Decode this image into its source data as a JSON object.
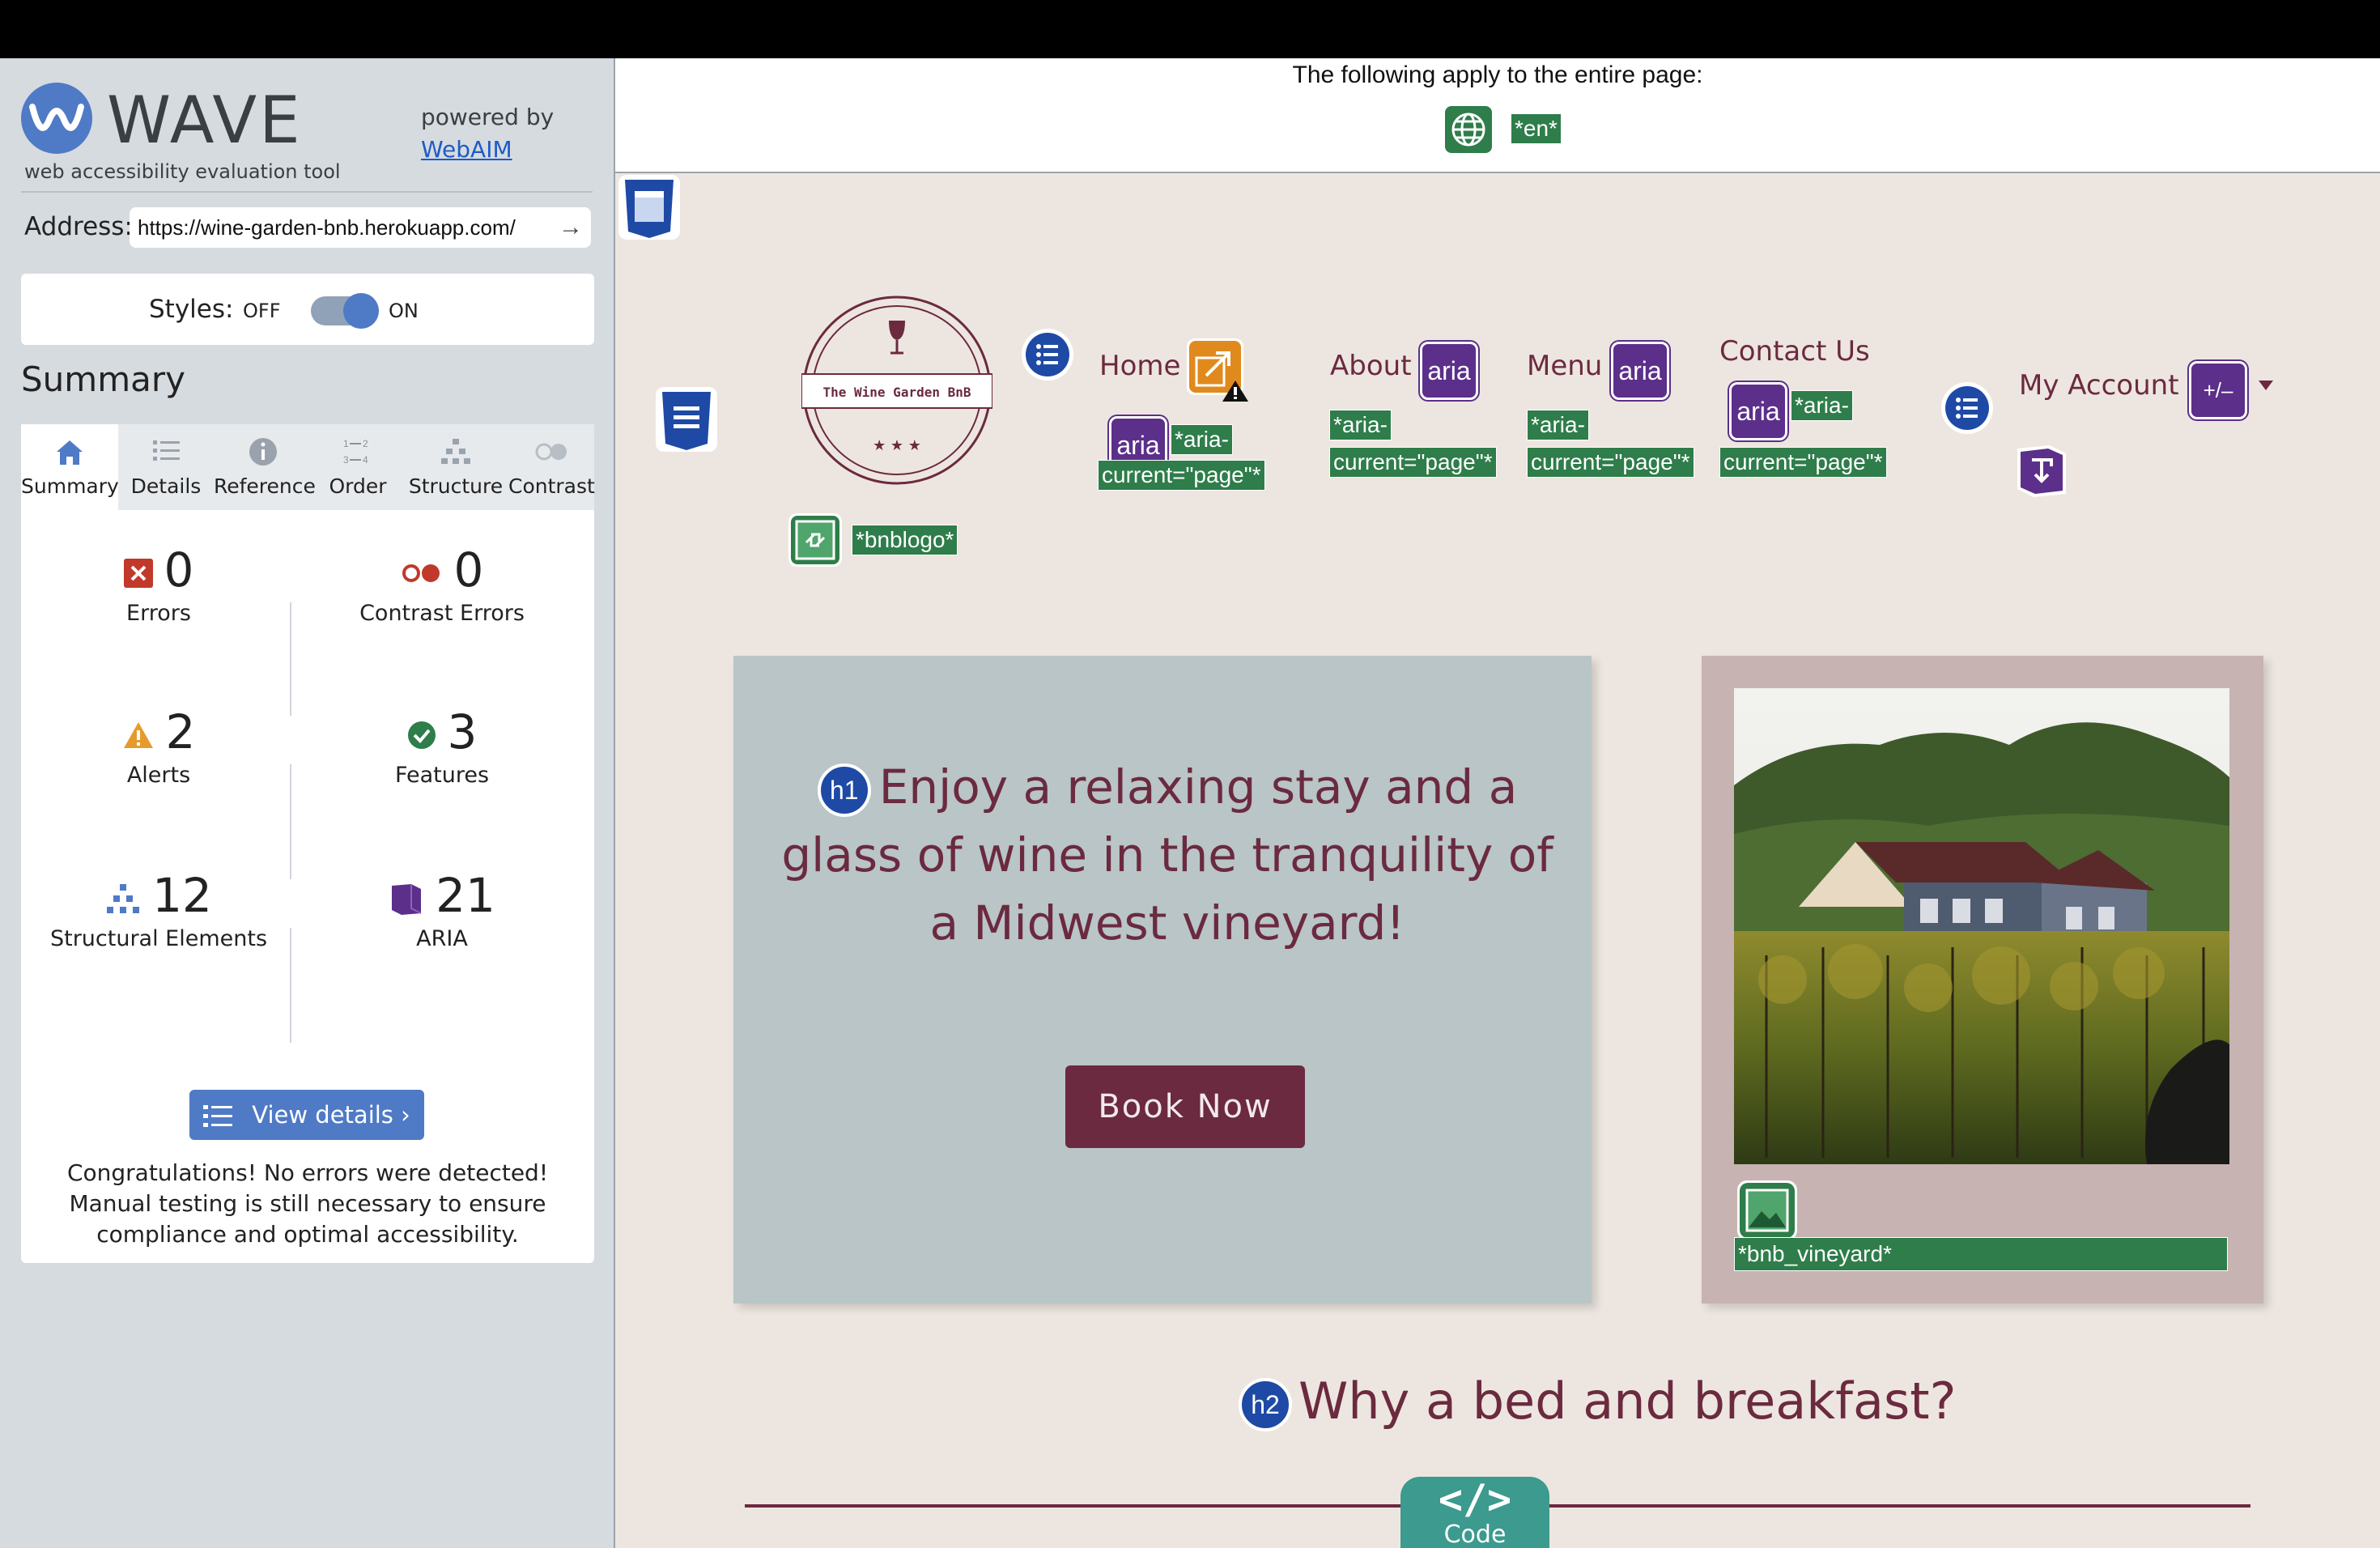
{
  "wave": {
    "title": "WAVE",
    "subtitle": "web accessibility evaluation tool",
    "powered_by": "powered by",
    "webaim": "WebAIM",
    "address_label": "Address:",
    "address_value": "https://wine-garden-bnb.herokuapp.com/",
    "styles_label": "Styles:",
    "styles_off": "OFF",
    "styles_on": "ON",
    "summary_title": "Summary",
    "tabs": [
      {
        "label": "Summary",
        "icon": "home-icon",
        "active": true
      },
      {
        "label": "Details",
        "icon": "list-icon"
      },
      {
        "label": "Reference",
        "icon": "info-icon"
      },
      {
        "label": "Order",
        "icon": "order-icon"
      },
      {
        "label": "Structure",
        "icon": "structure-icon"
      },
      {
        "label": "Contrast",
        "icon": "contrast-icon"
      }
    ],
    "stats": {
      "errors": {
        "count": "0",
        "label": "Errors"
      },
      "contrast_errors": {
        "count": "0",
        "label": "Contrast Errors"
      },
      "alerts": {
        "count": "2",
        "label": "Alerts"
      },
      "features": {
        "count": "3",
        "label": "Features"
      },
      "structural": {
        "count": "12",
        "label": "Structural Elements"
      },
      "aria": {
        "count": "21",
        "label": "ARIA"
      }
    },
    "view_details": "View details ›",
    "congrats": "Congratulations! No errors were detected! Manual testing is still necessary to ensure compliance and optimal accessibility."
  },
  "page": {
    "banner_text": "The following apply to the entire page:",
    "lang_tag": "*en*",
    "logo_text": "The Wine Garden BnB",
    "logo_stars": "★ ★ ★",
    "logo_tag": "*bnblogo*",
    "nav": {
      "home": "Home",
      "about": "About",
      "menu": "Menu",
      "contact": "Contact Us",
      "account": "My Account"
    },
    "aria_label": "aria",
    "aria_current_1": "*aria-",
    "aria_current_2": "current=\"page\"*",
    "plus_minus": "+/–",
    "hero_heading": "Enjoy a relaxing stay and a glass of wine in the tranquility of a Midwest vineyard!",
    "book_now": "Book Now",
    "image_tag": "*bnb_vineyard*",
    "h1_badge": "h1",
    "h2_badge": "h2",
    "h2_text": "Why a bed and breakfast?",
    "code_tab_symbol": "</>",
    "code_tab_label": "Code"
  },
  "colors": {
    "brand_wine": "#6b2a3f",
    "wave_blue": "#4f7ac5",
    "feature_green": "#2e7d4a",
    "aria_purple": "#5b2f8a",
    "hero_bg": "#b9c5c6",
    "page_bg": "#ede6e0"
  }
}
